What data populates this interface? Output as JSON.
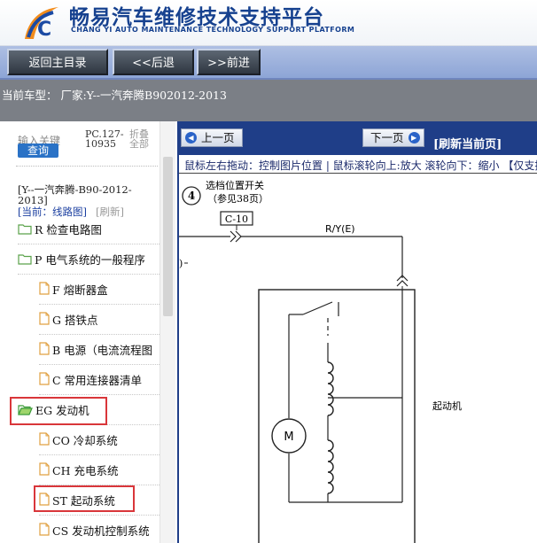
{
  "header": {
    "title": "畅易汽车维修技术支持平台",
    "subtitle": "CHANG YI AUTO MAINTENANCE TECHNOLOGY SUPPORT PLATFORM",
    "brand_color": "#16418f"
  },
  "nav": {
    "home": "返回主目录",
    "back": "<<后退",
    "forward": ">>前进"
  },
  "vehicle": {
    "text": "当前车型： 厂家:Y--一汽奔腾B902012-2013"
  },
  "sidebar": {
    "search_label": "输入关键",
    "search_button": "查询",
    "code": "PC.127-10935",
    "fold": "折叠全部",
    "current_vehicle": "[Y--一汽奔腾-B90-2012-2013]",
    "current_location": "[当前：线路图]",
    "refresh": "[刷新]",
    "items": [
      {
        "label": "R 检查电路图",
        "type": "folder"
      },
      {
        "label": "P 电气系统的一般程序",
        "type": "folder"
      },
      {
        "label": "F 熔断器盒",
        "type": "doc"
      },
      {
        "label": "G 搭铁点",
        "type": "doc"
      },
      {
        "label": "B 电源（电流流程图",
        "type": "doc"
      },
      {
        "label": "C 常用连接器清单",
        "type": "doc"
      },
      {
        "label": "EG 发动机",
        "type": "folder-open"
      },
      {
        "label": "CO 冷却系统",
        "type": "doc"
      },
      {
        "label": "CH 充电系统",
        "type": "doc"
      },
      {
        "label": "ST 起动系统",
        "type": "doc"
      },
      {
        "label": "CS 发动机控制系统",
        "type": "doc"
      }
    ]
  },
  "viewer": {
    "prev": "上一页",
    "next": "下一页",
    "refresh": "[刷新当前页]",
    "hint": "鼠标左右拖动：控制图片位置 | 鼠标滚轮向上:放大   滚轮向下：缩小 【仅支持",
    "bar_color": "#1f3e88"
  },
  "diagram": {
    "callout_number": "4",
    "switch_title": "选档位置开关",
    "switch_ref": "（参见38页）",
    "connector": "C-10",
    "wire": "R/Y(E)",
    "motor_symbol": "M",
    "starter_label": "起动机"
  }
}
